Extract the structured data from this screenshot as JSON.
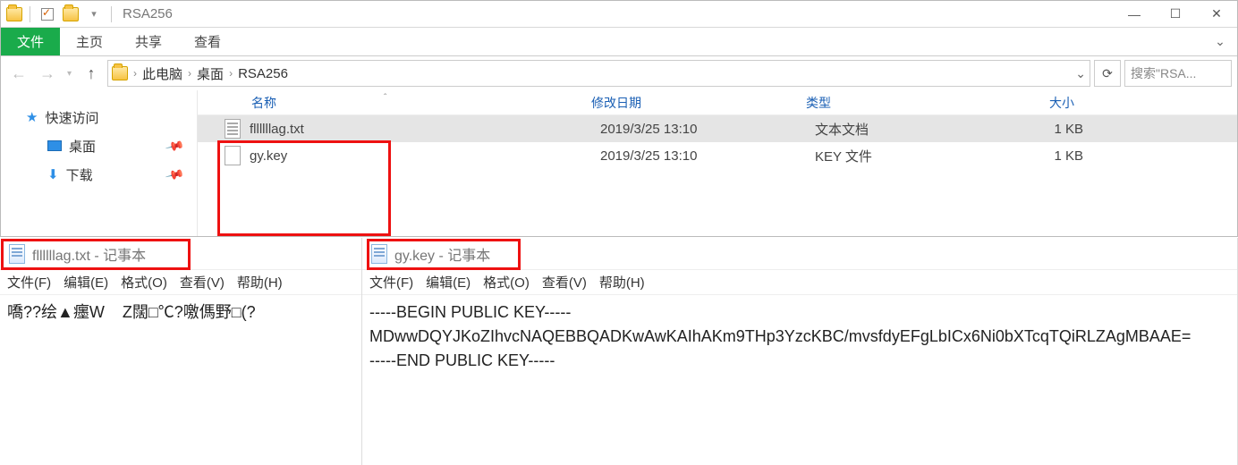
{
  "titlebar": {
    "title": "RSA256"
  },
  "winbtns": {
    "min": "—",
    "max": "☐",
    "close": "✕"
  },
  "ribbon": {
    "file": "文件",
    "tabs": [
      "主页",
      "共享",
      "查看"
    ],
    "collapse": "⌄"
  },
  "nav": {
    "back": "←",
    "forward": "→",
    "dropdown": "▾",
    "up": "↑"
  },
  "breadcrumb": {
    "items": [
      "此电脑",
      "桌面",
      "RSA256"
    ],
    "sep": "›",
    "dropdown": "⌄",
    "refresh": "⟳"
  },
  "search": {
    "placeholder": "搜索\"RSA..."
  },
  "sidebar": {
    "quick": "快速访问",
    "desktop": "桌面",
    "downloads": "下载"
  },
  "columns": {
    "name": "名称",
    "date": "修改日期",
    "type": "类型",
    "size": "大小",
    "sort": "ˆ"
  },
  "files": [
    {
      "name": "fllllllag.txt",
      "date": "2019/3/25 13:10",
      "type": "文本文档",
      "size": "1 KB",
      "selected": true,
      "icon": "txt"
    },
    {
      "name": "gy.key",
      "date": "2019/3/25 13:10",
      "type": "KEY 文件",
      "size": "1 KB",
      "selected": false,
      "icon": "blank"
    }
  ],
  "notepad_menu": {
    "file": "文件(F)",
    "edit": "编辑(E)",
    "format": "格式(O)",
    "view": "查看(V)",
    "help": "帮助(H)"
  },
  "notepad_suffix": " - 记事本",
  "notepad1": {
    "filename": "fllllllag.txt",
    "content": "嘺??绘▲癦W    Z闊□℃?噭傌野□(?"
  },
  "notepad2": {
    "filename": "gy.key",
    "content": "-----BEGIN PUBLIC KEY-----\nMDwwDQYJKoZIhvcNAQEBBQADKwAwKAIhAKm9THp3YzcKBC/mvsfdyEFgLbICx6Ni0bXTcqTQiRLZAgMBAAE=\n-----END PUBLIC KEY-----"
  }
}
